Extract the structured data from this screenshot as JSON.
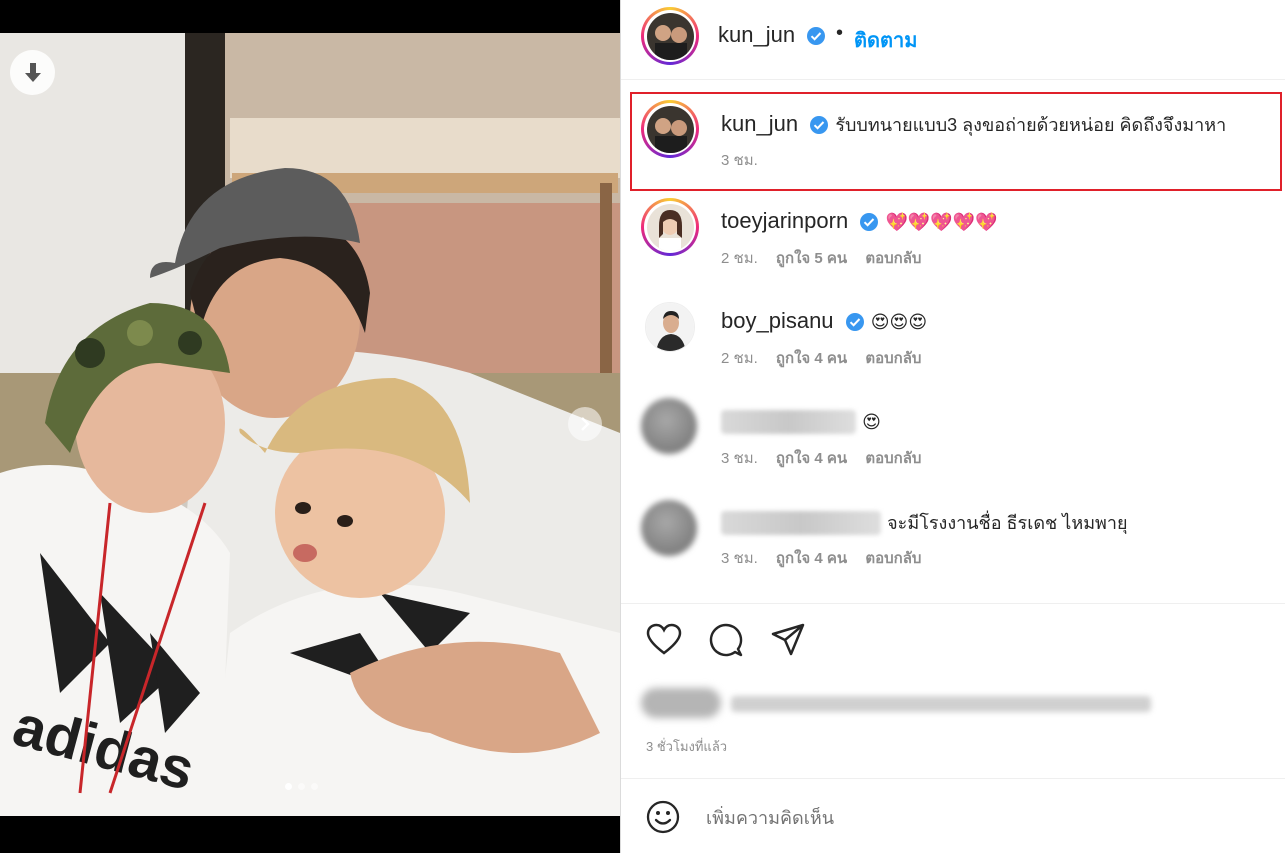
{
  "colors": {
    "accent": "#0095f6",
    "highlight_border": "#e0202a",
    "muted_text": "#8e8e8e",
    "verified_badge": "#3897f0"
  },
  "media": {
    "download_icon": "arrow-down-icon",
    "next_icon": "chevron-right-icon",
    "slides_total": 3,
    "active_slide": 1
  },
  "post_header": {
    "username": "kun_jun",
    "verified_icon": "verified-badge-icon",
    "separator": "•",
    "follow_label": "ติดตาม"
  },
  "caption": {
    "username": "kun_jun",
    "text": "รับบทนายแบบ3 ลุงขอถ่ายด้วยหน่อย คิดถึงจึงมาหา",
    "time": "3 ชม."
  },
  "comments": [
    {
      "username": "toeyjarinporn",
      "text": "💖💖💖💖💖",
      "time": "2 ชม.",
      "likes": "ถูกใจ 5 คน",
      "reply": "ตอบกลับ"
    },
    {
      "username": "boy_pisanu",
      "text": "😍😍😍",
      "time": "2 ชม.",
      "likes": "ถูกใจ 4 คน",
      "reply": "ตอบกลับ"
    },
    {
      "username": "",
      "text": "😍",
      "time": "3 ชม.",
      "likes": "ถูกใจ 4 คน",
      "reply": "ตอบกลับ"
    },
    {
      "username": "",
      "text": "จะมีโรงงานชื่อ ธีรเดช ไหมพายุ",
      "time": "3 ชม.",
      "likes": "ถูกใจ 4 คน",
      "reply": "ตอบกลับ"
    }
  ],
  "actions": {
    "like_icon": "heart-icon",
    "comment_icon": "comment-bubble-icon",
    "share_icon": "paper-plane-icon"
  },
  "post_time": "3 ชั่วโมงที่แล้ว",
  "add_comment": {
    "emoji_icon": "smiley-face-icon",
    "placeholder": "เพิ่มความคิดเห็น"
  }
}
